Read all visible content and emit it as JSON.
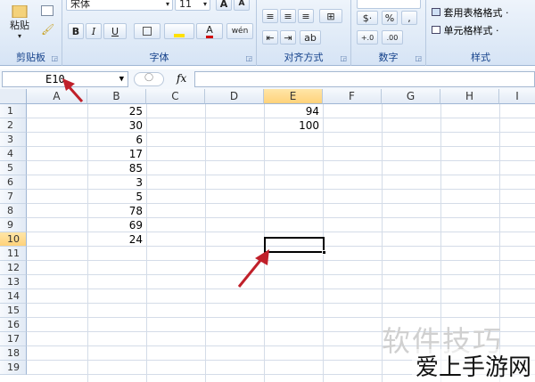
{
  "ribbon": {
    "paste_label": "粘贴",
    "font_name": "宋体",
    "font_size": "11",
    "groups": [
      {
        "label": "剪贴板"
      },
      {
        "label": "字体"
      },
      {
        "label": "对齐方式"
      },
      {
        "label": "数字"
      },
      {
        "label": "样式"
      }
    ],
    "table_style_label": "套用表格格式 ·",
    "cell_style_label": "单元格样式 ·",
    "bold": "B",
    "italic": "I",
    "underline": "U",
    "grow_font": "A",
    "shrink_font": "A",
    "font_color_letter": "A",
    "wen_label": "wén",
    "percent": "%",
    "comma": ","
  },
  "formula_bar": {
    "name_box": "E10",
    "fx": "fx",
    "formula": ""
  },
  "columns": [
    "A",
    "B",
    "C",
    "D",
    "E",
    "F",
    "G",
    "H",
    "I"
  ],
  "rows": [
    "1",
    "2",
    "3",
    "4",
    "5",
    "6",
    "7",
    "8",
    "9",
    "10",
    "11",
    "12",
    "13",
    "14",
    "15",
    "16",
    "17",
    "18",
    "19"
  ],
  "column_b": [
    "25",
    "30",
    "6",
    "17",
    "85",
    "3",
    "5",
    "78",
    "69",
    "24"
  ],
  "column_e": [
    "94",
    "100"
  ],
  "selected_cell": "E10",
  "watermarks": {
    "soft": "软件技巧",
    "site": "爱上手游网"
  },
  "colors": {
    "arrow": "#c0202a",
    "selection": "#000000",
    "header_highlight": "#ffd27a"
  }
}
